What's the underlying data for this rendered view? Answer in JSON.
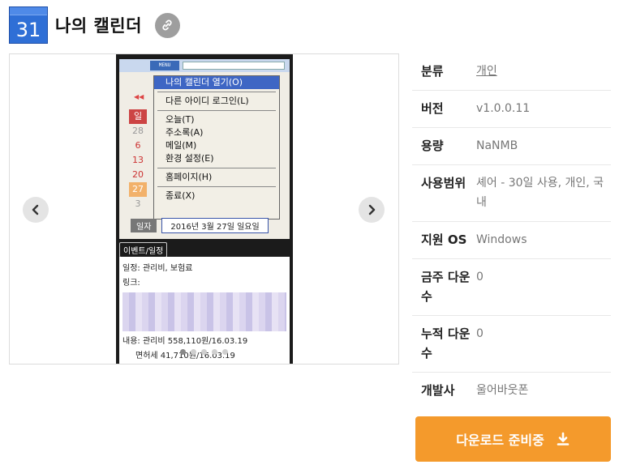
{
  "app": {
    "icon_text": "31",
    "title": "나의 캘린더",
    "link_icon": "link-icon"
  },
  "gallery": {
    "prev_icon": "chevron-left-icon",
    "next_icon": "chevron-right-icon",
    "dots": 5,
    "active_dot": 1,
    "screenshot": {
      "menu_tag": "MENU",
      "prev_button": "◀◀",
      "days": [
        "일",
        "28",
        "6",
        "13",
        "20",
        "27",
        "3"
      ],
      "menu_items": [
        "나의 캘린더 열기(O)",
        "다른 아이디 로그인(L)",
        "오늘(T)",
        "주소록(A)",
        "메일(M)",
        "환경 설정(E)",
        "홈페이지(H)",
        "종료(X)"
      ],
      "date_label": "일자",
      "date_value": "2016년 3월 27일 일요일",
      "event_tag": "이벤트/일정",
      "event_lines": [
        "일정: 관리비, 보험료",
        "링크:",
        "내용: 관리비 558,110원/16.03.19",
        "면허세 41,710원/16.03.19"
      ]
    }
  },
  "info": {
    "category_label": "분류",
    "category_value": "개인",
    "version_label": "버전",
    "version_value": "v1.0.0.11",
    "size_label": "용량",
    "size_value": "NaNMB",
    "license_label": "사용범위",
    "license_value": "셰어 - 30일 사용, 개인, 국내",
    "os_label": "지원 OS",
    "os_value": "Windows",
    "weekly_label": "금주 다운수",
    "weekly_value": "0",
    "total_label": "누적 다운수",
    "total_value": "0",
    "developer_label": "개발사",
    "developer_value": "울어바웃폰"
  },
  "download": {
    "label": "다운로드 준비중",
    "icon": "download-icon",
    "color": "#f49a2c"
  }
}
